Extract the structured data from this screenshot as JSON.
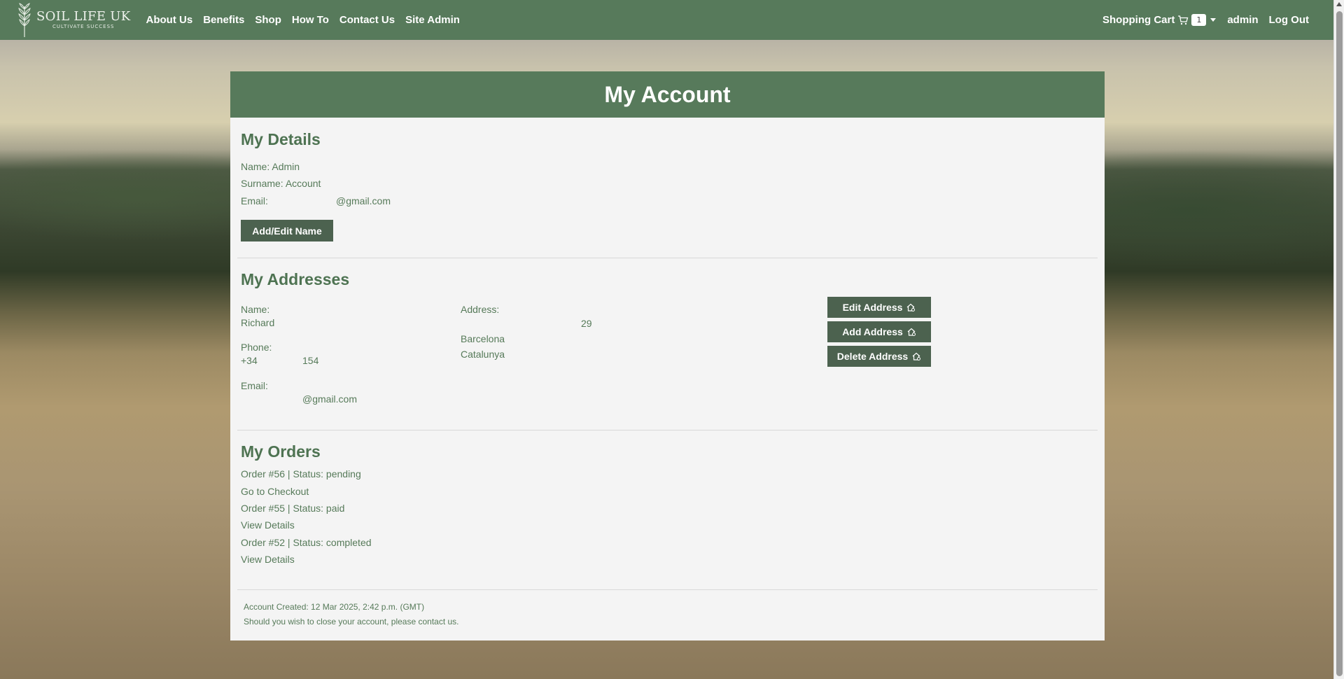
{
  "nav": {
    "brand_name": "SOIL LIFE UK",
    "brand_tagline": "CULTIVATE SUCCESS",
    "links": [
      "About Us",
      "Benefits",
      "Shop",
      "How To",
      "Contact Us",
      "Site Admin"
    ],
    "cart_label": "Shopping Cart",
    "cart_count": "1",
    "user": "admin",
    "logout": "Log Out"
  },
  "page_title": "My Account",
  "details": {
    "heading": "My Details",
    "name_line": "Name: Admin",
    "surname_line": "Surname: Account",
    "email_label": "Email:",
    "email_value": "@gmail.com",
    "edit_button": "Add/Edit Name"
  },
  "addresses": {
    "heading": "My Addresses",
    "name_label": "Name:",
    "name_value": "Richard",
    "phone_label": "Phone:",
    "phone_prefix": "+34",
    "phone_suffix": "154",
    "email_label": "Email:",
    "email_value": "@gmail.com",
    "address_label": "Address:",
    "address_number": "29",
    "city": "Barcelona",
    "region": "Catalunya",
    "edit_button": "Edit Address",
    "add_button": "Add Address",
    "delete_button": "Delete Address"
  },
  "orders": {
    "heading": "My Orders",
    "items": [
      {
        "label": "Order #56 | Status: pending",
        "action": "Go to Checkout"
      },
      {
        "label": "Order #55 | Status: paid",
        "action": "View Details"
      },
      {
        "label": "Order #52 | Status: completed",
        "action": "View Details"
      }
    ]
  },
  "footer": {
    "created": "Account Created: 12 Mar 2025, 2:42 p.m. (GMT)",
    "close_note": "Should you wish to close your account, please contact us."
  },
  "colors": {
    "primary_green": "#577a5b",
    "button_dark": "#4c624f",
    "text_green": "#567a59"
  }
}
